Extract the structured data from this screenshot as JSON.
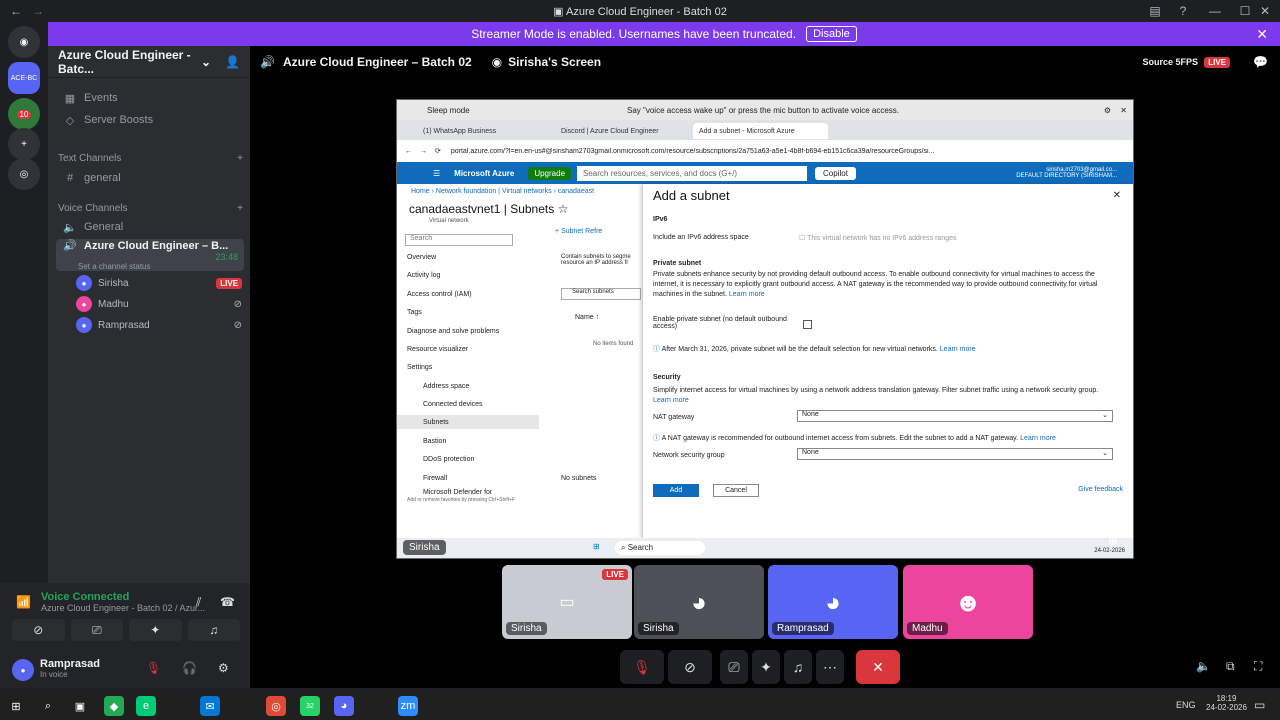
{
  "window": {
    "title": "Azure Cloud Engineer - Batch 02"
  },
  "banner": {
    "text": "Streamer Mode is enabled. Usernames have been truncated.",
    "disable_label": "Disable"
  },
  "server": {
    "name": "Azure Cloud Engineer - Batc...",
    "badge_ace": "ACE-BC",
    "badge_count": "10"
  },
  "sidebar": {
    "events": "Events",
    "boosts": "Server Boosts",
    "text_channels": "Text Channels",
    "general_text": "general",
    "voice_channels": "Voice Channels",
    "general_voice": "General",
    "active_voice": "Azure Cloud Engineer – B...",
    "active_timer": "23:48",
    "status_hint": "Set a channel status",
    "members": [
      {
        "name": "Sirisha",
        "live": "LIVE"
      },
      {
        "name": "Madhu"
      },
      {
        "name": "Ramprasad"
      }
    ]
  },
  "voice": {
    "status": "Voice Connected",
    "channel": "Azure Cloud Engineer - Batch 02 / Azur..."
  },
  "user": {
    "name": "Ramprasad",
    "status": "In voice"
  },
  "stage": {
    "channel": "Azure Cloud Engineer – Batch 02",
    "screen_label": "Sirisha's Screen",
    "source": "Source 5FPS",
    "live": "LIVE",
    "name_tag": "Sirisha"
  },
  "screen": {
    "sleep": "Sleep mode",
    "voice_tip": "Say \"voice access wake up\" or press the mic button to activate voice access.",
    "tabs": [
      "(1) WhatsApp Business",
      "Discord | Azure Cloud Engineer",
      "Add a subnet - Microsoft Azure"
    ],
    "url": "portal.azure.com/?l=en.en-us#@sirisham2703gmail.onmicrosoft.com/resource/subscriptions/2a751a63-a5e1-4b8f-b694-eb151c6ca39a/resourceGroups/si...",
    "azure": {
      "brand": "Microsoft Azure",
      "upgrade": "Upgrade",
      "search": "Search resources, services, and docs (G+/)",
      "copilot": "Copilot",
      "account": "sirisha.m2703@gmail.co...",
      "directory": "DEFAULT DIRECTORY (SIRISHAM..."
    },
    "breadcrumb": [
      "Home",
      "Network foundation | Virtual networks",
      "canadaeast"
    ],
    "resource_title": "canadaeastvnet1 | Subnets",
    "resource_sub": "Virtual network",
    "search_placeholder": "Search",
    "nav": [
      "Overview",
      "Activity log",
      "Access control (IAM)",
      "Tags",
      "Diagnose and solve problems",
      "Resource visualizer",
      "Settings",
      "Address space",
      "Connected devices",
      "Subnets",
      "Bastion",
      "DDoS protection",
      "Firewall",
      "Microsoft Defender for"
    ],
    "nav_footer": "Add or remove favorites by pressing Ctrl+Shift+F",
    "mid": {
      "subnet_btn": "+ Subnet",
      "refresh": "Refre",
      "desc": "Contain subnets to segme resource an IP address fr",
      "search": "Search subnets",
      "col_name": "Name ↑",
      "empty": "No items found",
      "no_subnets": "No subnets"
    },
    "panel": {
      "title": "Add a subnet",
      "ipv6_heading": "IPv6",
      "ipv6_label": "Include an IPv6 address space",
      "ipv6_note": "This virtual network has no IPv6 address ranges",
      "private_heading": "Private subnet",
      "private_desc": "Private subnets enhance security by not providing default outbound access. To enable outbound connectivity for virtual machines to access the internet, it is necessary to explicitly grant outbound access. A NAT gateway is the recommended way to provide outbound connectivity for virtual machines in the subnet.",
      "learn_more": "Learn more",
      "enable_private": "Enable private subnet (no default outbound access)",
      "info_private": "After March 31, 2026, private subnet will be the default selection for new virtual networks.",
      "security_heading": "Security",
      "security_desc": "Simplify internet access for virtual machines by using a network address translation gateway. Filter subnet traffic using a network security group.",
      "nat_label": "NAT gateway",
      "nat_value": "None",
      "nat_info": "A NAT gateway is recommended for outbound internet access from subnets. Edit the subnet to add a NAT gateway.",
      "nsg_label": "Network security group",
      "nsg_value": "None",
      "add": "Add",
      "cancel": "Cancel",
      "feedback": "Give feedback"
    },
    "taskbar": {
      "search": "Search",
      "date": "24-02-2026"
    }
  },
  "thumbs": [
    {
      "name": "Sirisha",
      "live": "LIVE"
    },
    {
      "name": "Sirisha"
    },
    {
      "name": "Ramprasad"
    },
    {
      "name": "Madhu"
    }
  ],
  "taskbar": {
    "lang": "ENG",
    "time": "18:19",
    "date": "24-02-2026",
    "whatsapp_badge": "32"
  }
}
